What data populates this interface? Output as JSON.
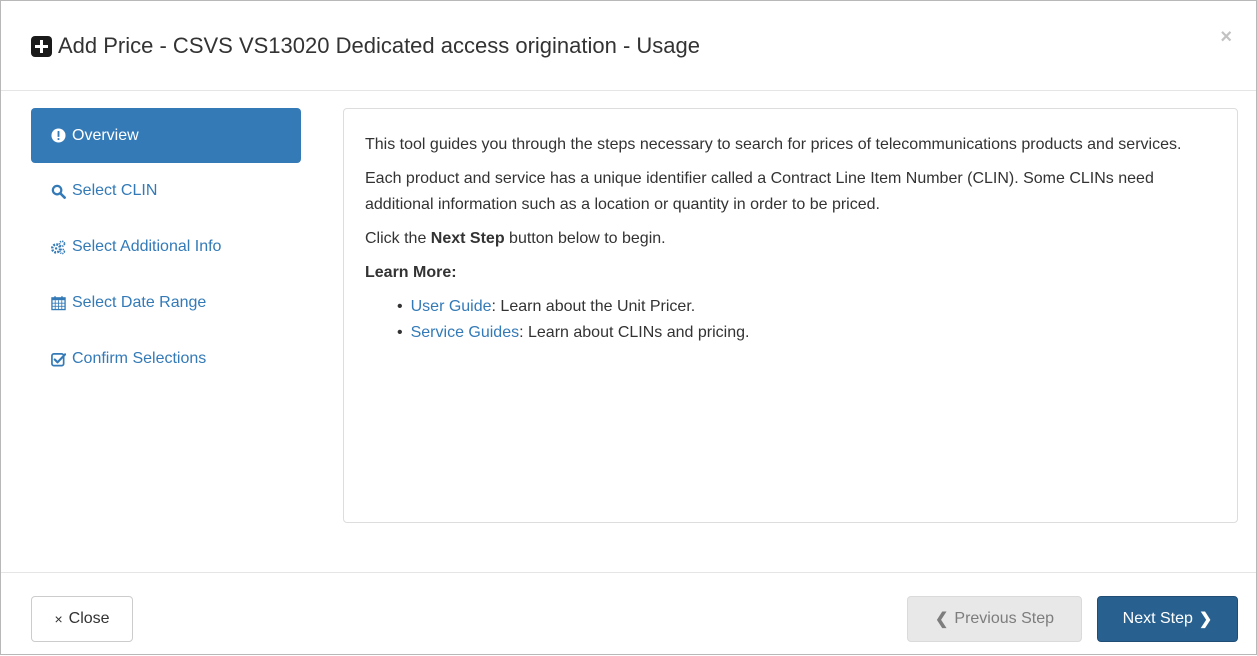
{
  "header": {
    "title": "Add Price - CSVS VS13020 Dedicated access origination - Usage",
    "title_icon": "plus-square-icon",
    "close_symbol": "×"
  },
  "sidebar": {
    "items": [
      {
        "label": "Overview",
        "icon": "exclamation-circle-icon",
        "active": true
      },
      {
        "label": "Select CLIN",
        "icon": "search-icon",
        "active": false
      },
      {
        "label": "Select Additional Info",
        "icon": "gears-icon",
        "active": false
      },
      {
        "label": "Select Date Range",
        "icon": "calendar-icon",
        "active": false
      },
      {
        "label": "Confirm Selections",
        "icon": "check-square-icon",
        "active": false
      }
    ]
  },
  "content": {
    "para1": "This tool guides you through the steps necessary to search for prices of telecommunications products and services.",
    "para2": "Each product and service has a unique identifier called a Contract Line Item Number (CLIN). Some CLINs need additional information such as a location or quantity in order to be priced.",
    "para3_prefix": "Click the ",
    "para3_bold": "Next Step",
    "para3_suffix": " button below to begin.",
    "learn_more_heading": "Learn More:",
    "links": [
      {
        "link_text": "User Guide",
        "rest": ": Learn about the Unit Pricer."
      },
      {
        "link_text": "Service Guides",
        "rest": ": Learn about CLINs and pricing."
      }
    ]
  },
  "footer": {
    "close_label": "Close",
    "close_symbol": "×",
    "prev_label": "Previous Step",
    "next_label": "Next Step",
    "prev_chevron": "❮",
    "next_chevron": "❯"
  },
  "colors": {
    "accent": "#337ab7",
    "primary_button": "#286090",
    "disabled_button": "#e6e6e6"
  }
}
